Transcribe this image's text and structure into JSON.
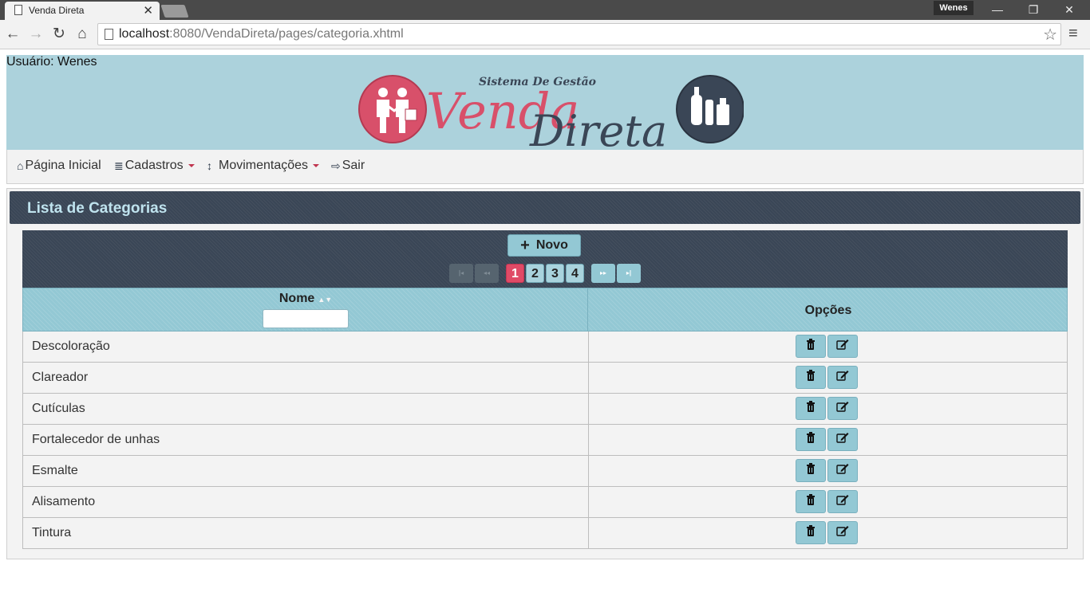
{
  "browser": {
    "tab_title": "Venda Direta",
    "tab_close": "✕",
    "profile": "Wenes",
    "window_controls": {
      "minimize": "—",
      "restore": "❐",
      "close": "✕"
    },
    "url_host": "localhost",
    "url_path": ":8080/VendaDireta/pages/categoria.xhtml",
    "icons": {
      "back": "←",
      "forward": "→",
      "reload": "↻",
      "home": "⌂",
      "star": "☆",
      "menu": "≡"
    }
  },
  "header": {
    "user_label": "Usuário: Wenes",
    "logo": {
      "subtitle": "Sistema De Gestão",
      "word1": "Venda",
      "word2": "Direta"
    }
  },
  "menu": {
    "items": [
      {
        "label": "Página Inicial",
        "icon": "home-icon",
        "glyph": "⌂"
      },
      {
        "label": "Cadastros",
        "icon": "database-icon",
        "glyph": "≣"
      },
      {
        "label": "Movimentações",
        "icon": "vertical-arrows-icon",
        "glyph": "↕"
      },
      {
        "label": "Sair",
        "icon": "sign-out-icon",
        "glyph": "⇨"
      }
    ]
  },
  "panel": {
    "title": "Lista de Categorias",
    "new_button": "Novo",
    "pager": {
      "first": "|◂",
      "prev": "◂◂",
      "next": "▸▸",
      "last": "▸|",
      "pages": [
        "1",
        "2",
        "3",
        "4"
      ],
      "current": "1"
    },
    "columns": {
      "nome": "Nome",
      "opcoes": "Opções"
    },
    "rows": [
      {
        "nome": "Descoloração"
      },
      {
        "nome": "Clareador"
      },
      {
        "nome": "Cutículas"
      },
      {
        "nome": "Fortalecedor de unhas"
      },
      {
        "nome": "Esmalte"
      },
      {
        "nome": "Alisamento"
      },
      {
        "nome": "Tintura"
      }
    ]
  },
  "colors": {
    "banner": "#acd2dc",
    "dark": "#3a4656",
    "accent": "#93c8d4",
    "active_page": "#e04a66"
  }
}
